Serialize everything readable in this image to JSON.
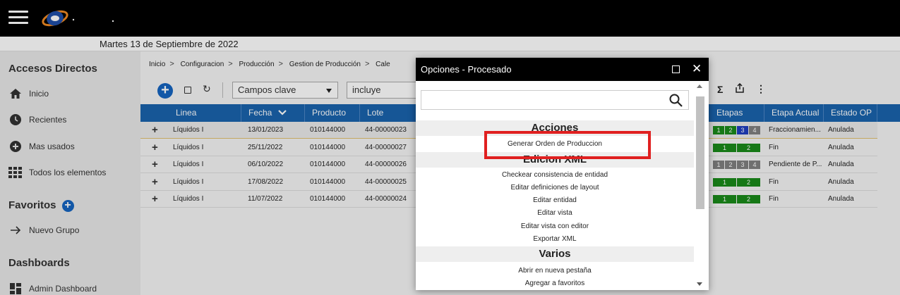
{
  "date_bar": {
    "text": "Martes 13 de Septiembre de 2022"
  },
  "sidebar": {
    "accesos_title": "Accesos Directos",
    "accesos": [
      {
        "label": "Inicio",
        "icon": "home-icon"
      },
      {
        "label": "Recientes",
        "icon": "clock-icon"
      },
      {
        "label": "Mas usados",
        "icon": "plus-circle-icon"
      },
      {
        "label": "Todos los elementos",
        "icon": "grid-icon"
      }
    ],
    "favoritos_title": "Favoritos",
    "favoritos": [
      {
        "label": "Nuevo Grupo",
        "icon": "arrow-right-icon"
      }
    ],
    "dashboards_title": "Dashboards",
    "dashboards": [
      {
        "label": "Admin Dashboard",
        "icon": "dashboard-icon"
      }
    ]
  },
  "breadcrumb": [
    "Inicio",
    "Configuracion",
    "Producción",
    "Gestion de Producción",
    "Cale"
  ],
  "toolbar": {
    "field_select": "Campos clave",
    "operator_select": "incluye"
  },
  "table": {
    "columns": [
      "Linea",
      "Fecha",
      "Producto",
      "Lote",
      "Etapas",
      "Etapa Actual",
      "Estado OP"
    ],
    "rows": [
      {
        "linea": "Líquidos I",
        "fecha": "13/01/2023",
        "producto": "010144000",
        "lote": "44-00000023",
        "stages": [
          "1",
          "2",
          "3",
          "4"
        ],
        "stage_colors": [
          "#1a8a1a",
          "#1a8a1a",
          "#1f3fbf",
          "#808080"
        ],
        "etapa": "Fraccionamien...",
        "estado": "Anulada"
      },
      {
        "linea": "Líquidos I",
        "fecha": "25/11/2022",
        "producto": "010144000",
        "lote": "44-00000027",
        "stages": [
          "1",
          "2"
        ],
        "stage_colors": [
          "#1a8a1a",
          "#1a8a1a"
        ],
        "etapa": "Fin",
        "estado": "Anulada"
      },
      {
        "linea": "Líquidos I",
        "fecha": "06/10/2022",
        "producto": "010144000",
        "lote": "44-00000026",
        "stages": [
          "1",
          "2",
          "3",
          "4"
        ],
        "stage_colors": [
          "#808080",
          "#808080",
          "#808080",
          "#808080"
        ],
        "etapa": "Pendiente de P...",
        "estado": "Anulada"
      },
      {
        "linea": "Líquidos I",
        "fecha": "17/08/2022",
        "producto": "010144000",
        "lote": "44-00000025",
        "stages": [
          "1",
          "2"
        ],
        "stage_colors": [
          "#1a8a1a",
          "#1a8a1a"
        ],
        "etapa": "Fin",
        "estado": "Anulada"
      },
      {
        "linea": "Líquidos I",
        "fecha": "11/07/2022",
        "producto": "010144000",
        "lote": "44-00000024",
        "stages": [
          "1",
          "2"
        ],
        "stage_colors": [
          "#1a8a1a",
          "#1a8a1a"
        ],
        "etapa": "Fin",
        "estado": "Anulada"
      }
    ]
  },
  "modal": {
    "title": "Opciones - Procesado",
    "search_value": "",
    "sections": [
      {
        "title": "Acciones",
        "items": [
          "Generar Orden de Produccion"
        ]
      },
      {
        "title": "Edicion XML",
        "items": [
          "Checkear consistencia de entidad",
          "Editar definiciones de layout",
          "Editar entidad",
          "Editar vista",
          "Editar vista con editor",
          "Exportar XML"
        ]
      },
      {
        "title": "Varios",
        "items": [
          "Abrir en nueva pestaña",
          "Agregar a favoritos"
        ]
      }
    ]
  },
  "colors": {
    "header_blue": "#1a63ad",
    "accent_blue": "#1565c0",
    "highlight_red": "#e02020"
  }
}
